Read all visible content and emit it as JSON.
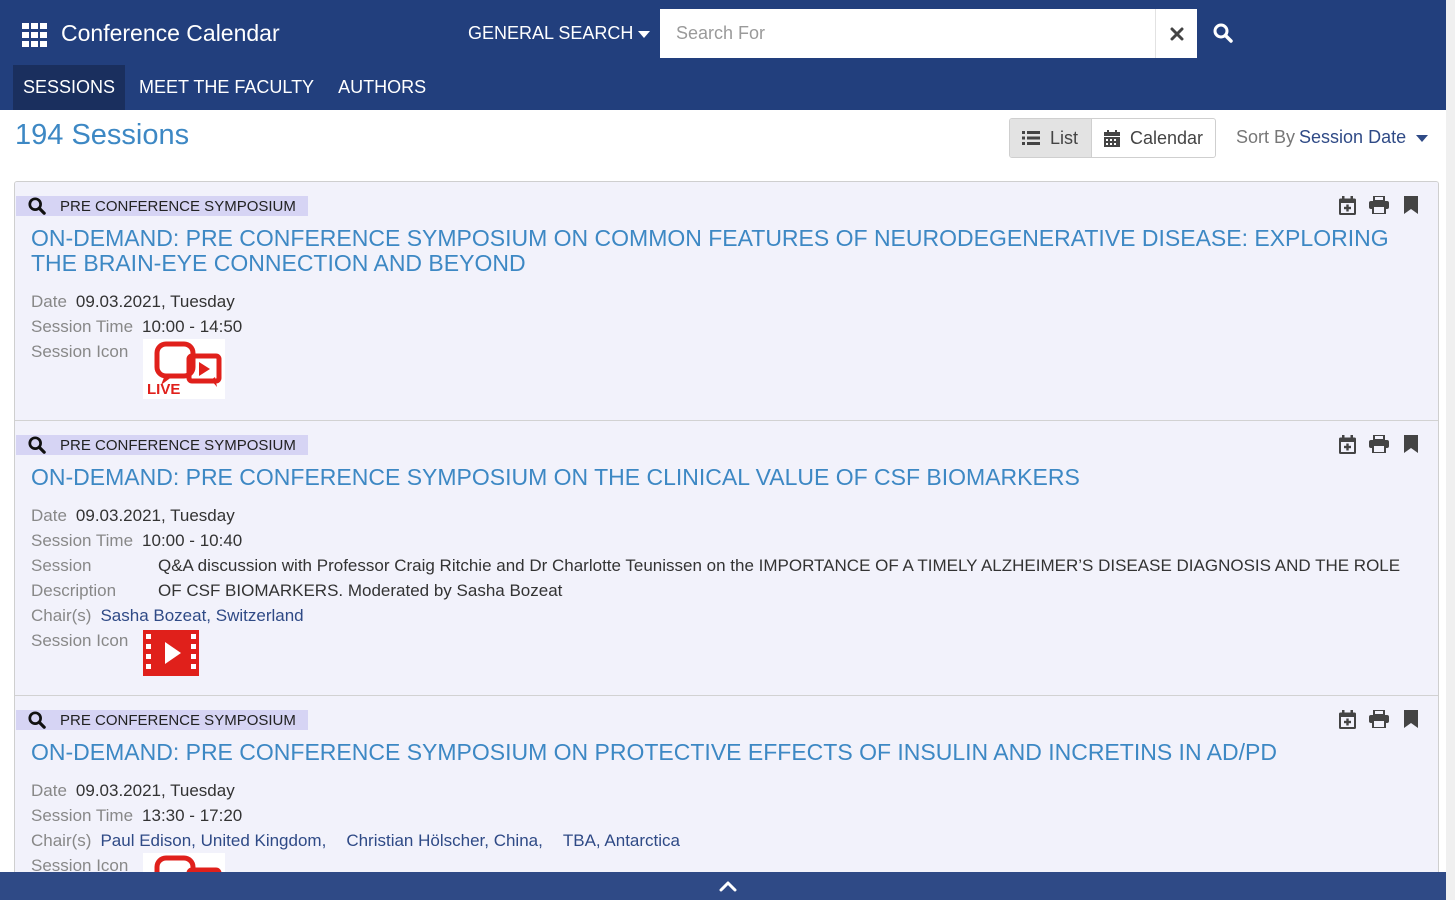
{
  "header": {
    "app_title": "Conference Calendar",
    "search_type": "GENERAL SEARCH",
    "search_placeholder": "Search For",
    "search_value": "",
    "nav": [
      {
        "label": "SESSIONS",
        "active": true
      },
      {
        "label": "MEET THE FACULTY",
        "active": false
      },
      {
        "label": "AUTHORS",
        "active": false
      }
    ],
    "colors": {
      "bar": "#223f7d",
      "active_tab": "#1a2f5e"
    }
  },
  "toolbar": {
    "count_title": "194 Sessions",
    "view_list": "List",
    "view_calendar": "Calendar",
    "active_view": "List",
    "sort_label": "Sort By",
    "sort_value": "Session Date"
  },
  "sessions": [
    {
      "track": "PRE CONFERENCE SYMPOSIUM",
      "title": "ON-DEMAND: PRE CONFERENCE SYMPOSIUM ON COMMON FEATURES OF NEURODEGENERATIVE DISEASE: EXPLORING THE BRAIN-EYE CONNECTION AND BEYOND",
      "date_label": "Date",
      "date": "09.03.2021, Tuesday",
      "time_label": "Session Time",
      "time": "10:00 - 14:50",
      "icon_label": "Session Icon",
      "icon": "live-icon",
      "icon_text": "LIVE"
    },
    {
      "track": "PRE CONFERENCE SYMPOSIUM",
      "title": "ON-DEMAND: PRE CONFERENCE SYMPOSIUM ON THE CLINICAL VALUE OF CSF BIOMARKERS",
      "date_label": "Date",
      "date": "09.03.2021, Tuesday",
      "time_label": "Session Time",
      "time": "10:00 - 10:40",
      "description_label_1": "Session",
      "description_label_2": "Description",
      "description": "Q&A discussion with Professor Craig Ritchie and Dr Charlotte Teunissen on the IMPORTANCE OF A TIMELY ALZHEIMER’S DISEASE DIAGNOSIS AND THE ROLE OF CSF BIOMARKERS. Moderated by Sasha Bozeat",
      "chairs_label": "Chair(s)",
      "chairs": [
        "Sasha Bozeat, Switzerland"
      ],
      "icon_label": "Session Icon",
      "icon": "video-play-icon"
    },
    {
      "track": "PRE CONFERENCE SYMPOSIUM",
      "title": "ON-DEMAND: PRE CONFERENCE SYMPOSIUM ON PROTECTIVE EFFECTS OF INSULIN AND INCRETINS IN AD/PD",
      "date_label": "Date",
      "date": "09.03.2021, Tuesday",
      "time_label": "Session Time",
      "time": "13:30 - 17:20",
      "chairs_label": "Chair(s)",
      "chairs": [
        "Paul Edison, United Kingdom,",
        "Christian Hölscher, China,",
        "TBA, Antarctica"
      ],
      "icon_label": "Session Icon",
      "icon": "live-icon"
    }
  ],
  "accent_colors": {
    "title_link": "#3d88c4",
    "track_badge": "#d6d4f4",
    "session_bg": "#f2f2fb",
    "icon_red": "#e0201b"
  }
}
